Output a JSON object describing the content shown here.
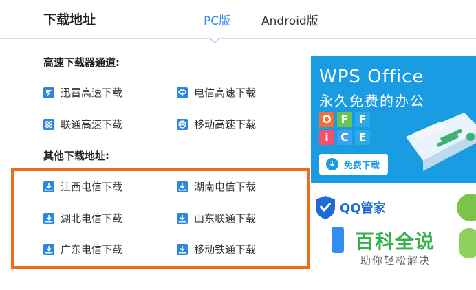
{
  "header": {
    "title": "下载地址",
    "tabs": [
      {
        "label": "PC版",
        "active": true
      },
      {
        "label": "Android版",
        "active": false
      }
    ]
  },
  "fast_section": {
    "label": "高速下载器通道:",
    "items": [
      {
        "label": "迅雷高速下载",
        "icon": "thunder-icon"
      },
      {
        "label": "电信高速下载",
        "icon": "telecom-icon"
      },
      {
        "label": "联通高速下载",
        "icon": "unicom-icon"
      },
      {
        "label": "移动高速下载",
        "icon": "mobile-icon"
      }
    ]
  },
  "other_section": {
    "label": "其他下载地址:",
    "items": [
      {
        "label": "江西电信下载",
        "icon": "download-icon"
      },
      {
        "label": "湖南电信下载",
        "icon": "download-icon"
      },
      {
        "label": "湖北电信下载",
        "icon": "download-icon"
      },
      {
        "label": "山东联通下载",
        "icon": "download-icon"
      },
      {
        "label": "广东电信下载",
        "icon": "download-icon"
      },
      {
        "label": "移动铁通下载",
        "icon": "download-icon"
      }
    ]
  },
  "ads": {
    "wps": {
      "logo": "WPS Office",
      "slogan": "永久免费的办公",
      "tiles": [
        "O",
        "F",
        "F",
        "i",
        "C",
        "E"
      ],
      "button": "免费下载"
    },
    "qq": {
      "name": "QQ管家"
    }
  },
  "watermark": {
    "title": "百科全说",
    "subtitle": "助你轻松解决"
  },
  "colors": {
    "accent": "#3b8ef0",
    "highlight_border": "#f26b1d",
    "wps_blue": "#1a9ce3",
    "brand_green": "#33b24a"
  }
}
